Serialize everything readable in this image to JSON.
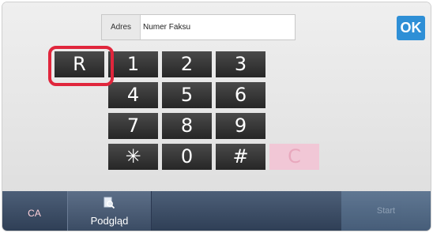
{
  "address": {
    "label": "Adres",
    "value": "Numer Faksu"
  },
  "ok_button": "OK",
  "keypad": {
    "r": "R",
    "keys": [
      "1",
      "2",
      "3",
      "4",
      "5",
      "6",
      "7",
      "8",
      "9",
      "✳",
      "0",
      "#",
      "C"
    ]
  },
  "bottom_bar": {
    "ca": "CA",
    "preview": "Podgląd",
    "start": "Start"
  },
  "colors": {
    "accent": "#2e8fd6",
    "highlight": "#e0263c",
    "clear_key": "#f1c7d6",
    "bottom_bar": "#3b4c64"
  },
  "icons": {
    "preview": "magnifier-document-icon"
  }
}
